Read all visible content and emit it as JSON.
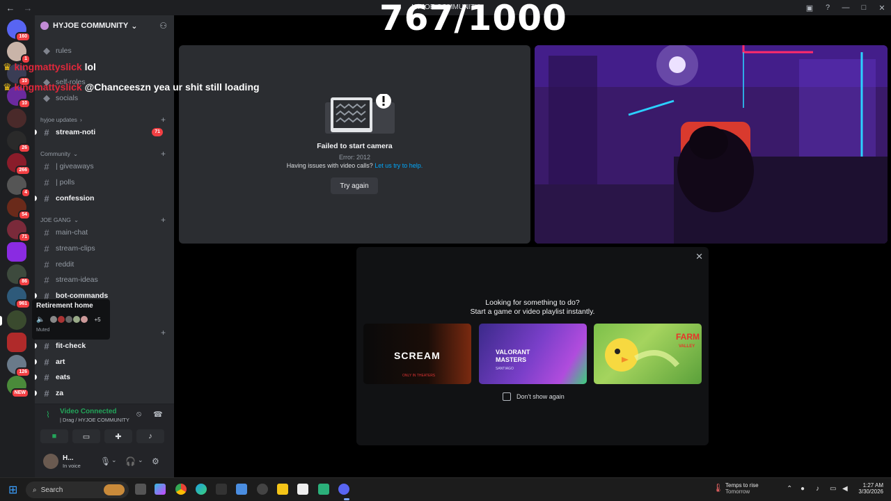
{
  "window": {
    "title": "HYJOE COMMUNITY"
  },
  "overlay": {
    "counter": "767/1000"
  },
  "chat_overlay": [
    {
      "user": "kingmattyslick",
      "message": "lol"
    },
    {
      "user": "kingmattyslick",
      "message": "@Chanceeszn yea ur shit still loading"
    }
  ],
  "server_rail": {
    "badges": [
      "160",
      "1",
      "10",
      "10",
      "26",
      "266",
      "4",
      "54",
      "71",
      "86",
      "961",
      "126",
      "NEW"
    ]
  },
  "sidebar": {
    "server_name": "HYJOE COMMUNITY",
    "channels_top": [
      "rules",
      "self-roles",
      "socials"
    ],
    "categories": {
      "hyjoe_updates": "hyjoe updates",
      "community": "Community",
      "joe_gang": "JOE GANG"
    },
    "stream_noti": {
      "name": "stream-noti",
      "count": "71"
    },
    "community_channels": [
      "| giveaways",
      "| polls",
      "confession"
    ],
    "joe_gang_channels": [
      "main-chat",
      "stream-clips",
      "reddit",
      "stream-ideas",
      "bot-commands"
    ],
    "after_channels": [
      "fit-check",
      "art",
      "eats",
      "za"
    ]
  },
  "tooltip": {
    "title": "Retirement home",
    "more": "+5",
    "status": "Muted"
  },
  "voice_panel": {
    "status": "Video Connected",
    "location": "| Drag / HYJOE COMMUNITY"
  },
  "user_panel": {
    "name": "H...",
    "status": "In voice"
  },
  "error_tile": {
    "title": "Failed to start camera",
    "code": "Error: 2012",
    "help_text": "Having issues with video calls?",
    "help_link": "Let us try to help.",
    "button": "Try again"
  },
  "activity_panel": {
    "heading1": "Looking for something to do?",
    "heading2": "Start a game or video playlist instantly.",
    "cards": [
      {
        "label": "SCREAM",
        "sub": "ONLY IN THEATERS"
      },
      {
        "label": "VALORANT MASTERS",
        "sub": "SANTIAGO"
      },
      {
        "label": "FARM",
        "sub": "VALLEY"
      }
    ],
    "dont_show": "Don't show again"
  },
  "taskbar": {
    "search": "Search",
    "weather_title": "Temps to rise",
    "weather_sub": "Tomorrow",
    "time": "1:27 AM",
    "date": "3/30/2026"
  },
  "colors": {
    "accent": "#5865f2",
    "online": "#23a55a",
    "danger": "#f23f43",
    "link": "#00a8fc"
  }
}
